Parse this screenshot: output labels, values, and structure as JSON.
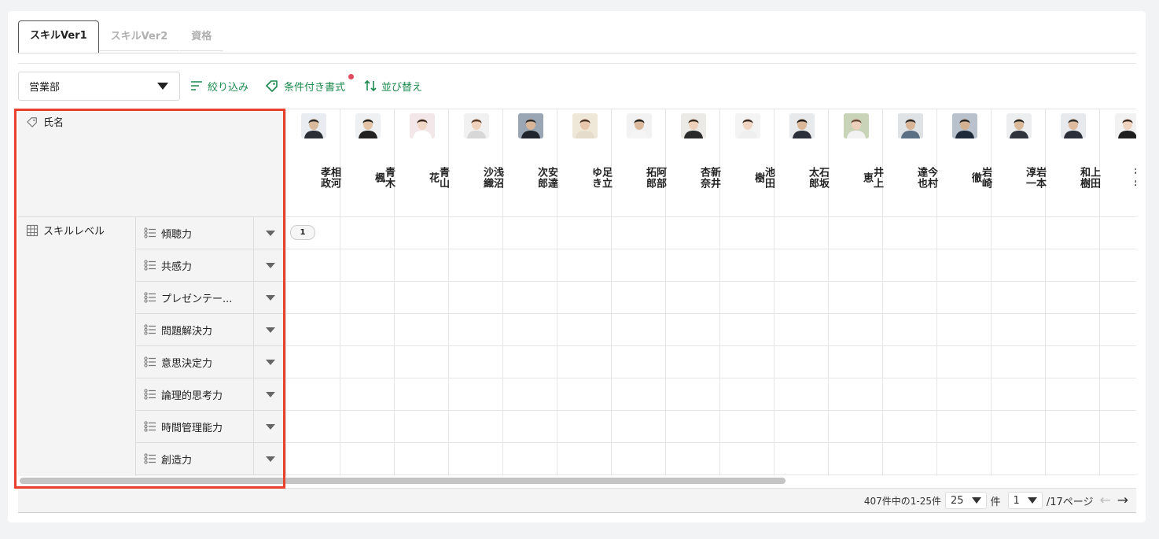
{
  "tabs": [
    {
      "label": "スキルVer1",
      "active": true
    },
    {
      "label": "スキルVer2",
      "active": false
    },
    {
      "label": "資格",
      "active": false
    }
  ],
  "toolbar": {
    "department": "営業部",
    "filter_label": "絞り込み",
    "conditional_format_label": "条件付き書式",
    "sort_label": "並び替え"
  },
  "table": {
    "name_header": "氏名",
    "skill_header": "スキルレベル",
    "skills": [
      "傾聴力",
      "共感力",
      "プレゼンテー...",
      "問題解決力",
      "意思決定力",
      "論理的思考力",
      "時間管理能力",
      "創造力"
    ],
    "people": [
      {
        "surname": "相河",
        "given": "孝政",
        "skin": "#d9b99b",
        "hair": "#2a2a2a",
        "bg": "#e9edf1",
        "shirt": "#2d2f36"
      },
      {
        "surname": "青木",
        "given": "楓",
        "skin": "#e2c3a6",
        "hair": "#1f1f1f",
        "bg": "#eef0f2",
        "shirt": "#222"
      },
      {
        "surname": "青山",
        "given": "花",
        "skin": "#f0d6c4",
        "hair": "#3a2a22",
        "bg": "#f3e7ea",
        "shirt": "#ffffff"
      },
      {
        "surname": "浅沼",
        "given": "沙織",
        "skin": "#efd2bd",
        "hair": "#5a3b26",
        "bg": "#f1f1f1",
        "shirt": "#d7d7d7"
      },
      {
        "surname": "安達",
        "given": "次郎",
        "skin": "#d8b597",
        "hair": "#2b2b2b",
        "bg": "#9aa6b4",
        "shirt": "#20242c"
      },
      {
        "surname": "足立",
        "given": "ゆき",
        "skin": "#e7c8ad",
        "hair": "#4a3526",
        "bg": "#efe7d7",
        "shirt": "#e6dccb"
      },
      {
        "surname": "阿部",
        "given": "拓郎",
        "skin": "#dcb99a",
        "hair": "#222",
        "bg": "#f2f2f2",
        "shirt": "#f5f5f5"
      },
      {
        "surname": "新井",
        "given": "杏奈",
        "skin": "#efd1bb",
        "hair": "#3b2a20",
        "bg": "#eceae6",
        "shirt": "#2a2a2a"
      },
      {
        "surname": "池田",
        "given": "樹",
        "skin": "#f0d5c2",
        "hair": "#3a2b24",
        "bg": "#f4f4f4",
        "shirt": "#efefef"
      },
      {
        "surname": "石坂",
        "given": "太郎",
        "skin": "#d9b797",
        "hair": "#1f1f1f",
        "bg": "#e8e9eb",
        "shirt": "#2b2f3a"
      },
      {
        "surname": "井上",
        "given": "恵",
        "skin": "#ecd0bb",
        "hair": "#6a4a36",
        "bg": "#c8d3b8",
        "shirt": "#f2f2f2"
      },
      {
        "surname": "今村",
        "given": "達也",
        "skin": "#d8b596",
        "hair": "#2b2b2b",
        "bg": "#dfe3e6",
        "shirt": "#5b6f85"
      },
      {
        "surname": "岩崎",
        "given": "徹",
        "skin": "#d4b092",
        "hair": "#222",
        "bg": "#b9c2cc",
        "shirt": "#1e2a3a"
      },
      {
        "surname": "岩本",
        "given": "淳一",
        "skin": "#dab898",
        "hair": "#262626",
        "bg": "#eceef0",
        "shirt": "#30343c"
      },
      {
        "surname": "上田",
        "given": "和樹",
        "skin": "#ddbb9c",
        "hair": "#2c2c2c",
        "bg": "#e7e9ec",
        "shirt": "#2a2e38"
      },
      {
        "surname": "臼井",
        "given": "祐希",
        "skin": "#efd3bf",
        "hair": "#3d2c22",
        "bg": "#f2f2f2",
        "shirt": "#1f1f1f"
      }
    ],
    "badge_value": "1"
  },
  "pagination": {
    "summary": "407件中の1-25件",
    "page_size": "25",
    "page_size_suffix": "件",
    "current_page": "1",
    "total_pages": "/17ページ"
  },
  "colors": {
    "accent_green": "#1c8a4e",
    "highlight_red": "#e8412c",
    "notification_dot": "#e44a5d"
  }
}
